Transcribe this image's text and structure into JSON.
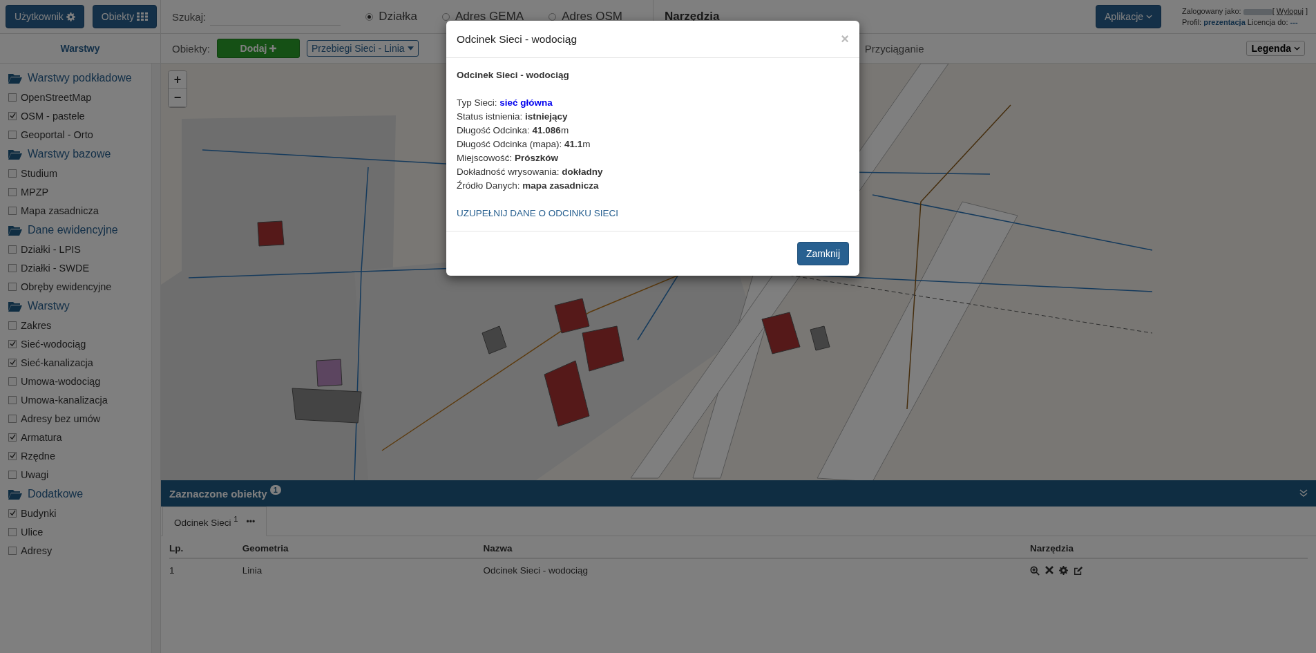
{
  "top_bar": {
    "user_button": "Użytkownik",
    "objects_button": "Obiekty",
    "search": {
      "label": "Szukaj:"
    },
    "search_modes": [
      {
        "label": "Działka",
        "selected": true
      },
      {
        "label": "Adres GEMA",
        "selected": false
      },
      {
        "label": "Adres OSM",
        "selected": false
      }
    ],
    "tools_label": "Narzędzia",
    "apps_button": "Aplikacje",
    "login": {
      "prefix": "Zalogowany jako:",
      "open_bracket": "[",
      "logout": "Wyloguj",
      "close_bracket": "]",
      "profile_label": "Profil:",
      "profile": "prezentacja",
      "license_label": "Licencja do:",
      "license": "---"
    }
  },
  "toolbar": {
    "label": "Obiekty:",
    "add_button": "Dodaj",
    "layer_select": "Przebiegi Sieci - Linia",
    "snapping": "Przyciąganie",
    "legend_button": "Legenda"
  },
  "sidebar": {
    "title": "Warstwy",
    "groups": [
      {
        "name": "Warstwy podkładowe",
        "items": [
          {
            "label": "OpenStreetMap",
            "checked": false
          },
          {
            "label": "OSM - pastele",
            "checked": true
          },
          {
            "label": "Geoportal - Orto",
            "checked": false
          }
        ]
      },
      {
        "name": "Warstwy bazowe",
        "items": [
          {
            "label": "Studium",
            "checked": false
          },
          {
            "label": "MPZP",
            "checked": false
          },
          {
            "label": "Mapa zasadnicza",
            "checked": false
          }
        ]
      },
      {
        "name": "Dane ewidencyjne",
        "items": [
          {
            "label": "Działki - LPIS",
            "checked": false
          },
          {
            "label": "Działki - SWDE",
            "checked": false
          },
          {
            "label": "Obręby ewidencyjne",
            "checked": false
          }
        ]
      },
      {
        "name": "Warstwy",
        "items": [
          {
            "label": "Zakres",
            "checked": false
          },
          {
            "label": "Sieć-wodociąg",
            "checked": true
          },
          {
            "label": "Sieć-kanalizacja",
            "checked": true
          },
          {
            "label": "Umowa-wodociąg",
            "checked": false
          },
          {
            "label": "Umowa-kanalizacja",
            "checked": false
          },
          {
            "label": "Adresy bez umów",
            "checked": false
          },
          {
            "label": "Armatura",
            "checked": true
          },
          {
            "label": "Rzędne",
            "checked": true
          },
          {
            "label": "Uwagi",
            "checked": false
          }
        ]
      },
      {
        "name": "Dodatkowe",
        "items": [
          {
            "label": "Budynki",
            "checked": true
          },
          {
            "label": "Ulice",
            "checked": false
          },
          {
            "label": "Adresy",
            "checked": false
          }
        ]
      }
    ]
  },
  "map": {
    "zoom_in": "+",
    "zoom_out": "−"
  },
  "modal": {
    "title": "Odcinek Sieci - wodociąg",
    "close": "×",
    "heading": "Odcinek Sieci - wodociąg",
    "fields": [
      {
        "label": "Typ Sieci:",
        "value": "sieć główna",
        "kind": "highlight"
      },
      {
        "label": "Status istnienia:",
        "value": "istniejący",
        "kind": "plain"
      },
      {
        "label": "Długość Odcinka:",
        "value": "41.086",
        "unit": "m",
        "kind": "plain"
      },
      {
        "label": "Długość Odcinka (mapa):",
        "value": "41.1",
        "unit": "m",
        "kind": "plain"
      },
      {
        "label": "Miejscowość:",
        "value": "Prószków",
        "kind": "plain"
      },
      {
        "label": "Dokładność wrysowania:",
        "value": "dokładny",
        "kind": "plain"
      },
      {
        "label": "Źródło Danych:",
        "value": "mapa zasadnicza",
        "kind": "plain"
      }
    ],
    "action_link": "UZUPEŁNIJ DANE O ODCINKU SIECI",
    "close_button": "Zamknij"
  },
  "selection_panel": {
    "title": "Zaznaczone obiekty",
    "badge": "1",
    "tabs": [
      {
        "label": "Odcinek Sieci $^{1}$",
        "selected": true
      }
    ],
    "more": "•••",
    "columns": [
      "Lp.",
      "Geometria",
      "Nazwa",
      "Narzędzia"
    ],
    "rows": [
      {
        "cells": [
          "1",
          "Linia",
          "Odcinek Sieci - wodociąg"
        ]
      }
    ]
  }
}
